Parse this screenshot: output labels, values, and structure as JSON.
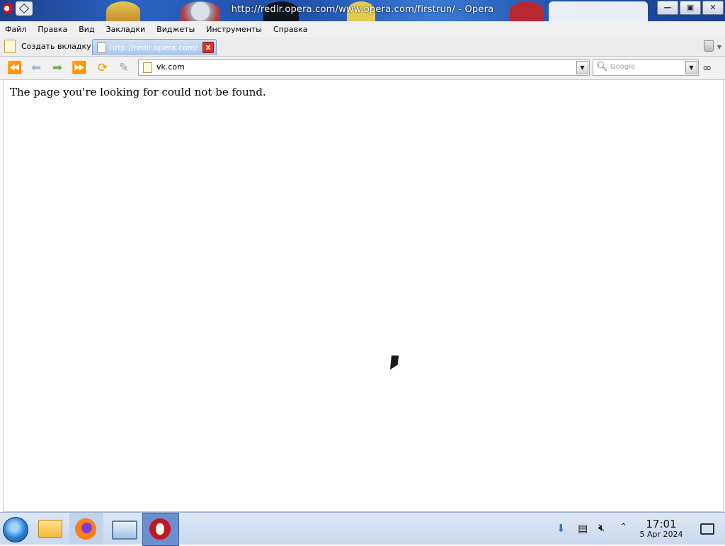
{
  "window": {
    "title": "http://redir.opera.com/www.opera.com/firstrun/ - Opera",
    "buttons": {
      "minimize": "—",
      "maximize": "▣",
      "close": "✕"
    }
  },
  "menu": [
    "Файл",
    "Правка",
    "Вид",
    "Закладки",
    "Виджеты",
    "Инструменты",
    "Справка"
  ],
  "tabs": {
    "new_tab_label": "Создать вкладку",
    "active_tab_label": "http://redir.opera.com/...",
    "close_glyph": "x"
  },
  "toolbar": {
    "url_value": "vk.com",
    "search_placeholder": "Google",
    "icons": [
      "rewind-icon",
      "back-icon",
      "forward-icon",
      "fast-forward-icon",
      "reload-icon",
      "edit-icon",
      "search-icon",
      "binoculars-icon"
    ]
  },
  "page": {
    "message": "The page you're looking for could not be found."
  },
  "taskbar": {
    "time": "17:01",
    "date": "5 Apr 2024",
    "apps": [
      "start-button",
      "file-manager",
      "firefox",
      "network-monitor",
      "opera"
    ],
    "tray_icons": [
      "updates-icon",
      "clipboard-icon",
      "volume-muted-icon",
      "tray-expand-icon",
      "show-desktop-icon"
    ]
  },
  "colors": {
    "titlebar": "#2a63c4",
    "active_tab": "#a9c5e8",
    "taskbar": "#c8d9ee",
    "opera_red": "#c4161c"
  }
}
